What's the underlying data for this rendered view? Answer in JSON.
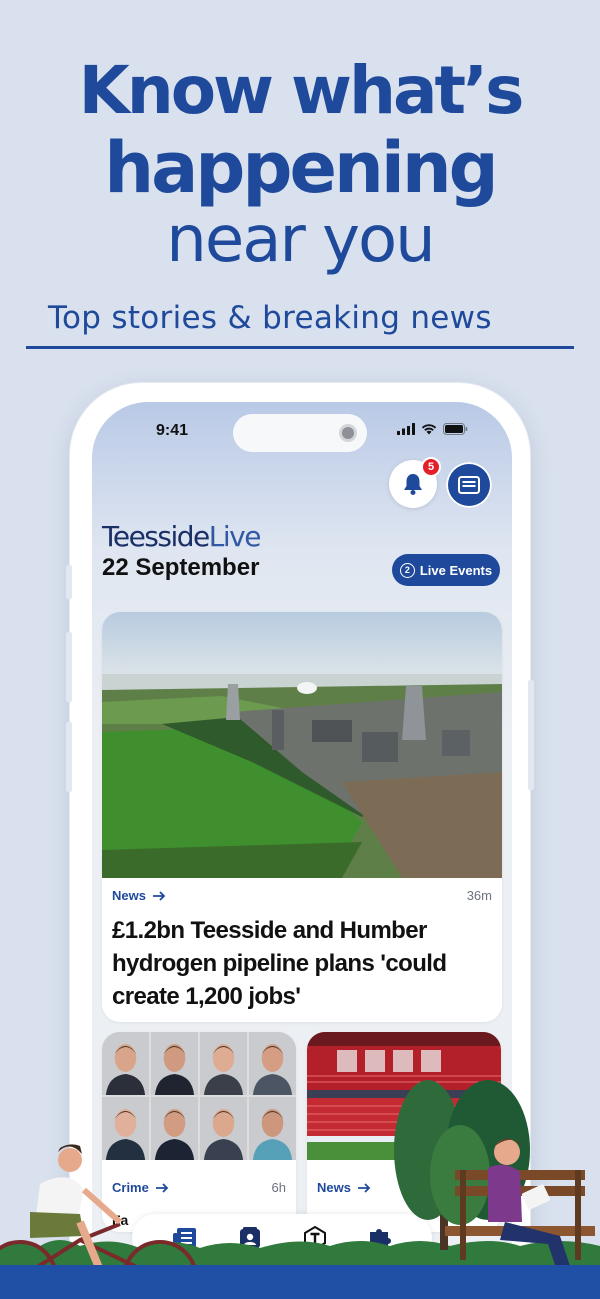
{
  "hero": {
    "line1": "Know what’s",
    "line2": "happening",
    "line3": "near you",
    "tagline": "Top stories & breaking news"
  },
  "status_bar": {
    "time": "9:41"
  },
  "header": {
    "notification_count": "5",
    "brand_part1": "Teesside",
    "brand_part2": "Live",
    "date": "22 September",
    "live_events_count": "2",
    "live_events_label": "Live Events"
  },
  "main_story": {
    "category": "News",
    "age": "36m",
    "title": "£1.2bn Teesside and Humber hydrogen pipeline plans 'could create 1,200 jobs'"
  },
  "small_stories": [
    {
      "category": "Crime",
      "age": "6h",
      "title_peek": "Fa"
    },
    {
      "category": "News",
      "age": "",
      "title_peek": ""
    }
  ],
  "bottom_tabs": [
    {
      "icon": "news-icon"
    },
    {
      "icon": "profile-card-icon"
    },
    {
      "icon": "t-logo-icon"
    },
    {
      "icon": "puzzle-icon"
    }
  ],
  "colors": {
    "brand_blue": "#1f4a9c",
    "badge_red": "#e3202a",
    "background": "#d9e1ee"
  }
}
